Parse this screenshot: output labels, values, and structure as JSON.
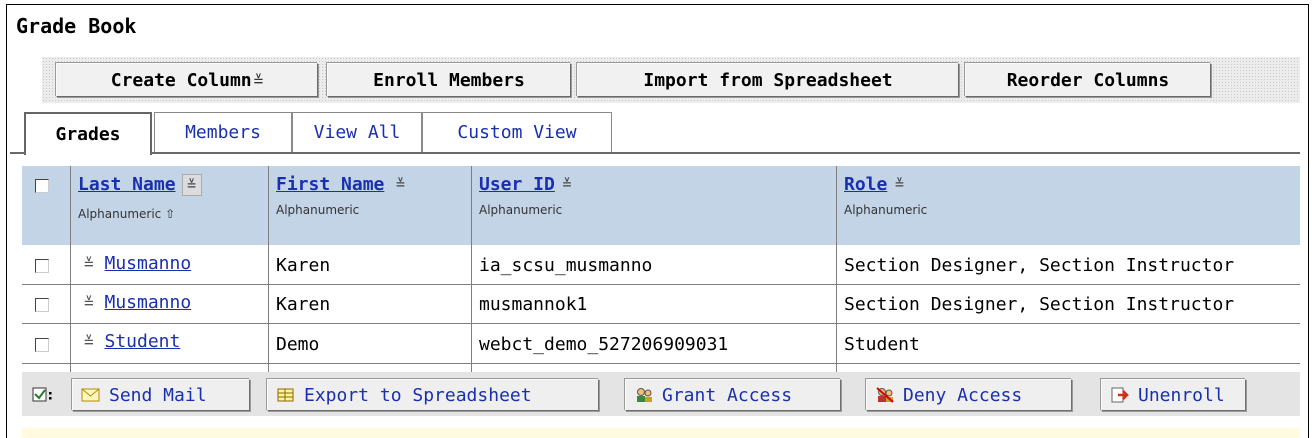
{
  "page": {
    "title": "Grade Book"
  },
  "toolbar": {
    "create_column": "Create Column",
    "enroll_members": "Enroll Members",
    "import_spreadsheet": "Import from Spreadsheet",
    "reorder_columns": "Reorder Columns"
  },
  "tabs": [
    {
      "label": "Grades",
      "active": true
    },
    {
      "label": "Members",
      "active": false
    },
    {
      "label": "View All",
      "active": false
    },
    {
      "label": "Custom View",
      "active": false
    }
  ],
  "table": {
    "columns": [
      {
        "name": "Last Name",
        "type": "Alphanumeric",
        "sorted": "ascending"
      },
      {
        "name": "First Name",
        "type": "Alphanumeric"
      },
      {
        "name": "User ID",
        "type": "Alphanumeric"
      },
      {
        "name": "Role",
        "type": "Alphanumeric"
      }
    ],
    "rows": [
      {
        "last_name": "Musmanno",
        "first_name": "Karen",
        "user_id": "ia_scsu_musmanno",
        "role": "Section Designer, Section Instructor"
      },
      {
        "last_name": "Musmanno",
        "first_name": "Karen",
        "user_id": "musmannok1",
        "role": "Section Designer, Section Instructor"
      },
      {
        "last_name": "Student",
        "first_name": "Demo",
        "user_id": "webct_demo_527206909031",
        "role": "Student"
      }
    ]
  },
  "actions": {
    "send_mail": "Send Mail",
    "export_spreadsheet": "Export to Spreadsheet",
    "grant_access": "Grant Access",
    "deny_access": "Deny Access",
    "unenroll": "Unenroll"
  },
  "colors": {
    "header_bg": "#c3d4e7",
    "link": "#1a2fae",
    "footer_bg": "#e4e4e4",
    "message_bg": "#fffbe0"
  }
}
